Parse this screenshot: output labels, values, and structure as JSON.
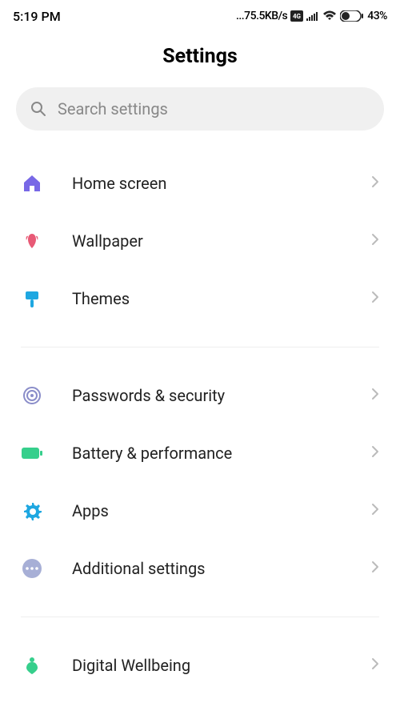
{
  "status": {
    "time": "5:19 PM",
    "speed": "...75.5KB/s",
    "network_icons": "📶 4G ᴴᴰ ⁴ᴳ",
    "battery": "43%"
  },
  "title": "Settings",
  "search": {
    "placeholder": "Search settings"
  },
  "groups": [
    {
      "items": [
        {
          "id": "home-screen",
          "label": "Home screen",
          "icon": "home",
          "color": "#7868e6"
        },
        {
          "id": "wallpaper",
          "label": "Wallpaper",
          "icon": "tulip",
          "color": "#e85a76"
        },
        {
          "id": "themes",
          "label": "Themes",
          "icon": "brush",
          "color": "#1ea7e1"
        }
      ]
    },
    {
      "items": [
        {
          "id": "passwords-security",
          "label": "Passwords & security",
          "icon": "fingerprint",
          "color": "#8a8dc9"
        },
        {
          "id": "battery-performance",
          "label": "Battery & performance",
          "icon": "battery",
          "color": "#36cf8c"
        },
        {
          "id": "apps",
          "label": "Apps",
          "icon": "gear",
          "color": "#1ea7e1"
        },
        {
          "id": "additional-settings",
          "label": "Additional settings",
          "icon": "dots",
          "color": "#a7afd6"
        }
      ]
    },
    {
      "items": [
        {
          "id": "digital-wellbeing",
          "label": "Digital Wellbeing",
          "icon": "wellbeing",
          "color": "#36cf8c"
        }
      ]
    }
  ]
}
